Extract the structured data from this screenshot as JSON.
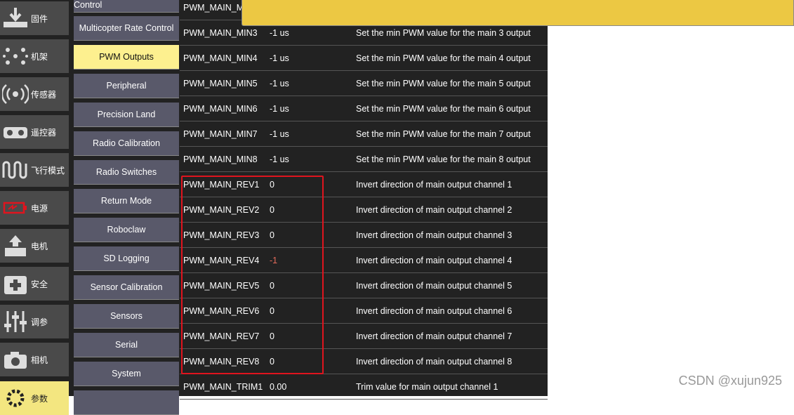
{
  "left_nav": [
    {
      "label": "固件",
      "icon": "download-icon",
      "active": false
    },
    {
      "label": "机架",
      "icon": "airframe-icon",
      "active": false
    },
    {
      "label": "传感器",
      "icon": "sensor-icon",
      "active": false
    },
    {
      "label": "遥控器",
      "icon": "remote-controller-icon",
      "active": false
    },
    {
      "label": "飞行模式",
      "icon": "flight-mode-icon",
      "active": false
    },
    {
      "label": "电源",
      "icon": "battery-icon",
      "active": false
    },
    {
      "label": "电机",
      "icon": "motor-icon",
      "active": false
    },
    {
      "label": "安全",
      "icon": "safety-icon",
      "active": false
    },
    {
      "label": "调参",
      "icon": "tuning-icon",
      "active": false
    },
    {
      "label": "相机",
      "icon": "camera-icon",
      "active": false
    },
    {
      "label": "参数",
      "icon": "gear-icon",
      "active": true
    }
  ],
  "groups": [
    {
      "label": "Multicopter Position Control",
      "active": false
    },
    {
      "label": "Multicopter Rate Control",
      "active": false
    },
    {
      "label": "PWM Outputs",
      "active": true
    },
    {
      "label": "Peripheral",
      "active": false
    },
    {
      "label": "Precision Land",
      "active": false
    },
    {
      "label": "Radio Calibration",
      "active": false
    },
    {
      "label": "Radio Switches",
      "active": false
    },
    {
      "label": "Return Mode",
      "active": false
    },
    {
      "label": "Roboclaw",
      "active": false
    },
    {
      "label": "SD Logging",
      "active": false
    },
    {
      "label": "Sensor Calibration",
      "active": false
    },
    {
      "label": "Sensors",
      "active": false
    },
    {
      "label": "Serial",
      "active": false
    },
    {
      "label": "System",
      "active": false
    }
  ],
  "params": [
    {
      "name": "PWM_MAIN_M",
      "value": "",
      "desc": ""
    },
    {
      "name": "PWM_MAIN_MIN3",
      "value": "-1 us",
      "desc": "Set the min PWM value for the main 3 output"
    },
    {
      "name": "PWM_MAIN_MIN4",
      "value": "-1 us",
      "desc": "Set the min PWM value for the main 4 output"
    },
    {
      "name": "PWM_MAIN_MIN5",
      "value": "-1 us",
      "desc": "Set the min PWM value for the main 5 output"
    },
    {
      "name": "PWM_MAIN_MIN6",
      "value": "-1 us",
      "desc": "Set the min PWM value for the main 6 output"
    },
    {
      "name": "PWM_MAIN_MIN7",
      "value": "-1 us",
      "desc": "Set the min PWM value for the main 7 output"
    },
    {
      "name": "PWM_MAIN_MIN8",
      "value": "-1 us",
      "desc": "Set the min PWM value for the main 8 output"
    },
    {
      "name": "PWM_MAIN_REV1",
      "value": "0",
      "desc": "Invert direction of main output channel 1"
    },
    {
      "name": "PWM_MAIN_REV2",
      "value": "0",
      "desc": "Invert direction of main output channel 2"
    },
    {
      "name": "PWM_MAIN_REV3",
      "value": "0",
      "desc": "Invert direction of main output channel 3"
    },
    {
      "name": "PWM_MAIN_REV4",
      "value": "-1",
      "desc": "Invert direction of main output channel 4",
      "modified": true
    },
    {
      "name": "PWM_MAIN_REV5",
      "value": "0",
      "desc": "Invert direction of main output channel 5"
    },
    {
      "name": "PWM_MAIN_REV6",
      "value": "0",
      "desc": "Invert direction of main output channel 6"
    },
    {
      "name": "PWM_MAIN_REV7",
      "value": "0",
      "desc": "Invert direction of main output channel 7"
    },
    {
      "name": "PWM_MAIN_REV8",
      "value": "0",
      "desc": "Invert direction of main output channel 8"
    },
    {
      "name": "PWM_MAIN_TRIM1",
      "value": "0.00",
      "desc": "Trim value for main output channel 1"
    }
  ],
  "watermark": "CSDN @xujun925",
  "colors": {
    "accent": "#fdf08f",
    "banner": "#ecc843",
    "highlight_box": "#e0141e",
    "modified_value": "#e66b5b"
  }
}
